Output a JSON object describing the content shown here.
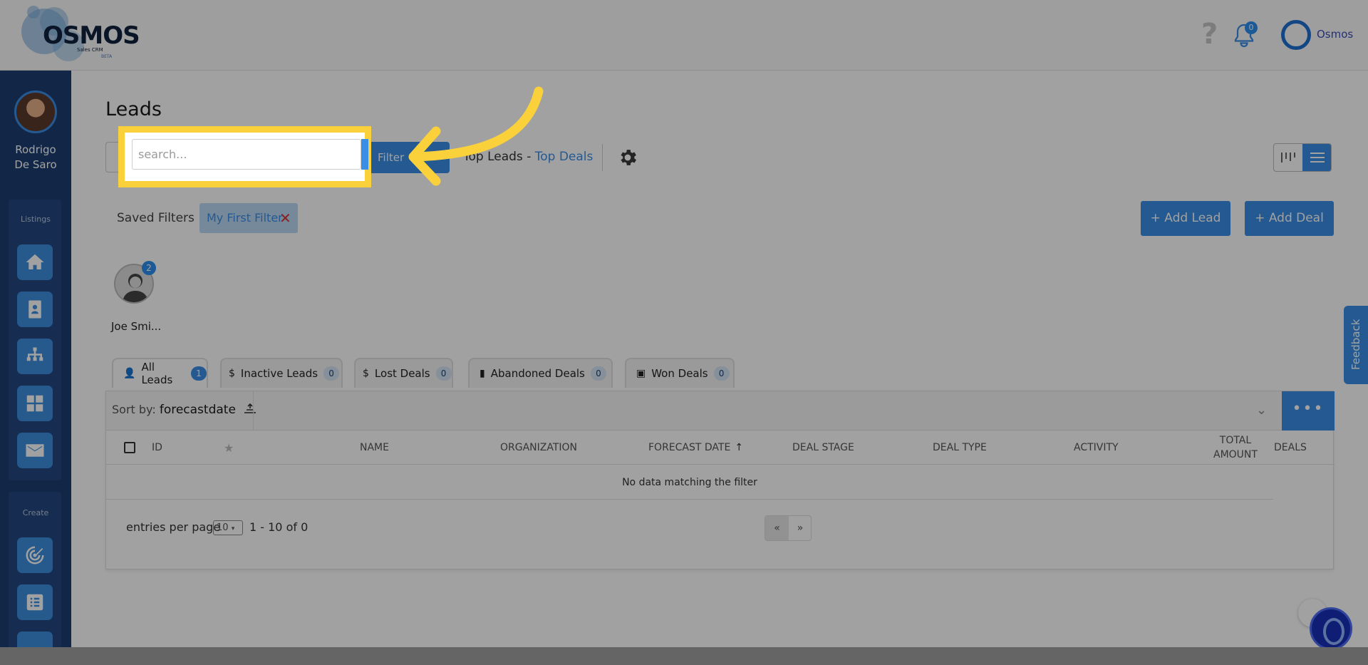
{
  "header": {
    "logo_text": "OSMOS",
    "logo_subtitle": "Sales CRM",
    "logo_beta": "BETA",
    "help_icon": "question-mark-icon",
    "bell_icon": "bell-icon",
    "notification_count": "0",
    "user_name": "Osmos"
  },
  "sidebar": {
    "user_first": "Rodrigo",
    "user_last": "De Saro",
    "listings_title": "Listings",
    "create_title": "Create",
    "listing_icons": [
      "home-icon",
      "contact-card-icon",
      "org-chart-icon",
      "grid-icon",
      "envelope-icon"
    ],
    "create_icons": [
      "target-icon",
      "checklist-icon"
    ]
  },
  "main": {
    "title": "Leads",
    "search_placeholder": "search...",
    "filter_label": "Filter",
    "quick_link_prefix": "Top Leads - ",
    "quick_link": "Top Deals",
    "saved_filters_label": "Saved Filters :",
    "saved_filter_chip": "My First Filter",
    "add_lead": "+ Add Lead",
    "add_deal": "+ Add Deal",
    "person_name": "Joe Smi...",
    "person_badge": "2"
  },
  "tabs": [
    {
      "label": "All Leads",
      "count": "1",
      "icon": "user-icon"
    },
    {
      "label": "Inactive Leads",
      "count": "0",
      "icon": "dollar-icon"
    },
    {
      "label": "Lost Deals",
      "count": "0",
      "icon": "dollar-icon"
    },
    {
      "label": "Abandoned Deals",
      "count": "0",
      "icon": "clipboard-icon"
    },
    {
      "label": "Won Deals",
      "count": "0",
      "icon": "card-icon"
    }
  ],
  "table": {
    "sort_prefix": "Sort by:",
    "sort_field": "forecastdate",
    "more_label": "•••",
    "columns": [
      "ID",
      "NAME",
      "ORGANIZATION",
      "FORECAST DATE",
      "DEAL STAGE",
      "DEAL TYPE",
      "ACTIVITY",
      "TOTAL AMOUNT",
      "DEALS"
    ],
    "total_amount_line1": "TOTAL",
    "total_amount_line2": "AMOUNT",
    "empty_message": "No data matching the filter",
    "entries_label": "entries per page",
    "page_size": "10",
    "range": "1 - 10 of 0",
    "prev": "«",
    "next": "»"
  },
  "feedback_label": "Feedback"
}
